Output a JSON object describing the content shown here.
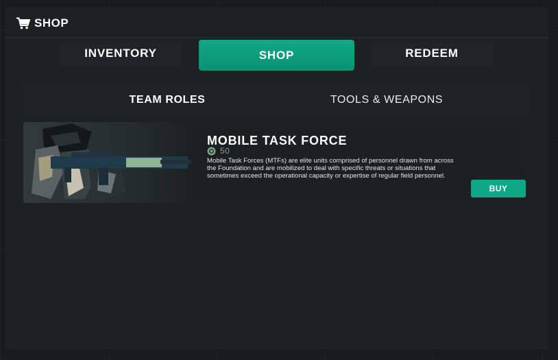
{
  "header": {
    "title": "SHOP",
    "icon": "cart-icon"
  },
  "tabs": [
    {
      "label": "INVENTORY",
      "active": false
    },
    {
      "label": "SHOP",
      "active": true
    },
    {
      "label": "REDEEM",
      "active": false
    }
  ],
  "subtabs": [
    {
      "label": "TEAM ROLES",
      "active": true
    },
    {
      "label": "TOOLS & WEAPONS",
      "active": false
    }
  ],
  "items": [
    {
      "name": "MOBILE TASK FORCE",
      "price_icon": "coin-icon",
      "price": "50",
      "description": "Mobile Task Forces (MTFs) are elite units comprised of personnel drawn from across the Foundation and are mobilized to deal with specific threats or situations that sometimes exceed the operational capacity or expertise of regular field personnel.",
      "buy_label": "BUY"
    }
  ],
  "colors": {
    "accent": "#0fa886",
    "price": "#7ea48c",
    "panel": "#1d2123"
  }
}
